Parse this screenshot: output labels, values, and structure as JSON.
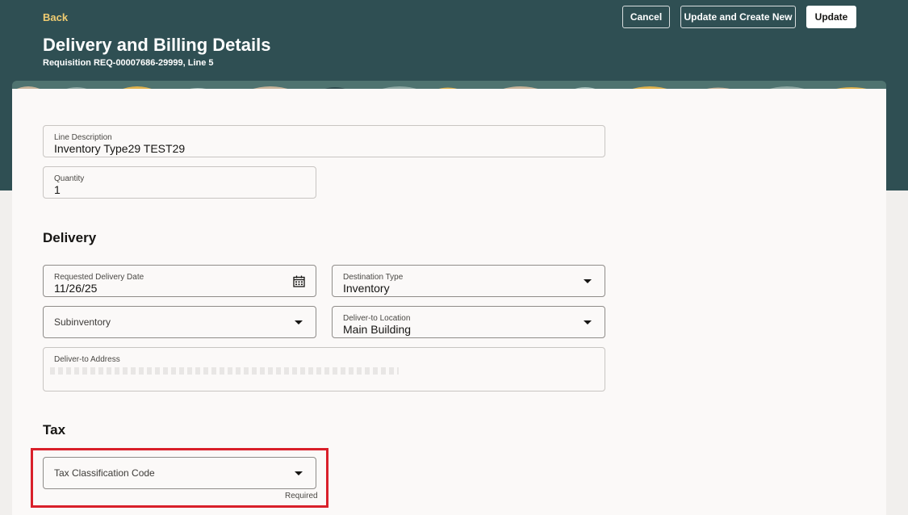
{
  "header": {
    "back_label": "Back",
    "title": "Delivery and Billing Details",
    "subtitle": "Requisition REQ-00007686-29999, Line 5",
    "cancel_label": "Cancel",
    "update_create_label": "Update and Create New",
    "update_label": "Update"
  },
  "fields": {
    "line_description": {
      "label": "Line Description",
      "value": "Inventory Type29 TEST29"
    },
    "quantity": {
      "label": "Quantity",
      "value": "1"
    },
    "requested_delivery_date": {
      "label": "Requested Delivery Date",
      "value": "11/26/25",
      "icon": "calendar-icon"
    },
    "destination_type": {
      "label": "Destination Type",
      "value": "Inventory"
    },
    "subinventory": {
      "label": "Subinventory"
    },
    "deliver_to_location": {
      "label": "Deliver-to Location",
      "value": "Main Building"
    },
    "deliver_to_address": {
      "label": "Deliver-to Address"
    },
    "tax_classification_code": {
      "label": "Tax Classification Code",
      "helper": "Required"
    }
  },
  "sections": {
    "delivery": "Delivery",
    "tax": "Tax"
  },
  "colors": {
    "header_bg": "#2f4f53",
    "back_link": "#f0cc71",
    "highlight": "#d9202a"
  }
}
